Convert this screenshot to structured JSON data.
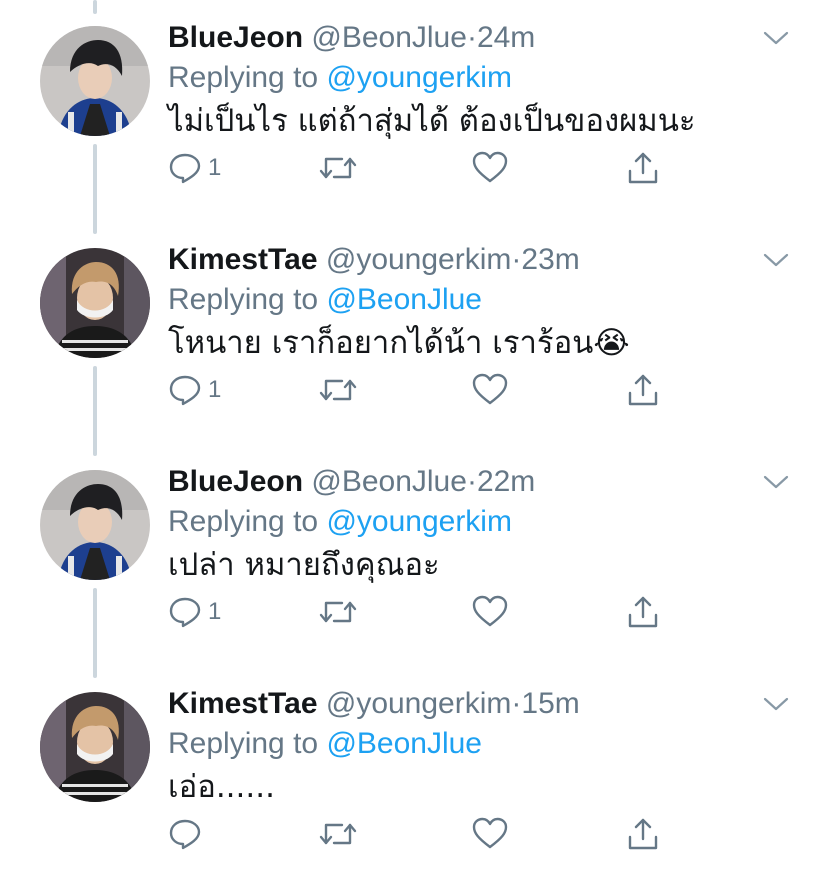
{
  "tweets": [
    {
      "name": "BlueJeon",
      "handle": "@BeonJlue",
      "dot": "·",
      "time": "24m",
      "replying_prefix": "Replying to",
      "replying_to": "@youngerkim",
      "text": "ไม่เป็นไร แต่ถ้าสุ่มได้ ต้องเป็นของผมนะ",
      "reply_count": "1",
      "avatar": "bluejeon-avatar"
    },
    {
      "name": "KimestTae",
      "handle": "@youngerkim",
      "dot": "·",
      "time": "23m",
      "replying_prefix": "Replying to",
      "replying_to": "@BeonJlue",
      "text": "โหนาย เราก็อยากได้น้า เราร้อน😭",
      "reply_count": "1",
      "avatar": "kimesttae-avatar"
    },
    {
      "name": "BlueJeon",
      "handle": "@BeonJlue",
      "dot": "·",
      "time": "22m",
      "replying_prefix": "Replying to",
      "replying_to": "@youngerkim",
      "text": "เปล่า หมายถึงคุณอะ",
      "reply_count": "1",
      "avatar": "bluejeon-avatar"
    },
    {
      "name": "KimestTae",
      "handle": "@youngerkim",
      "dot": "·",
      "time": "15m",
      "replying_prefix": "Replying to",
      "replying_to": "@BeonJlue",
      "text": "เอ่อ......",
      "reply_count": "",
      "avatar": "kimesttae-avatar"
    }
  ],
  "colors": {
    "text": "#14171a",
    "secondary": "#657786",
    "link": "#1da1f2",
    "thread_line": "#ccd6dd"
  },
  "icons": {
    "reply": "reply-icon",
    "retweet": "retweet-icon",
    "like": "heart-icon",
    "share": "share-icon",
    "menu": "chevron-down-icon"
  }
}
